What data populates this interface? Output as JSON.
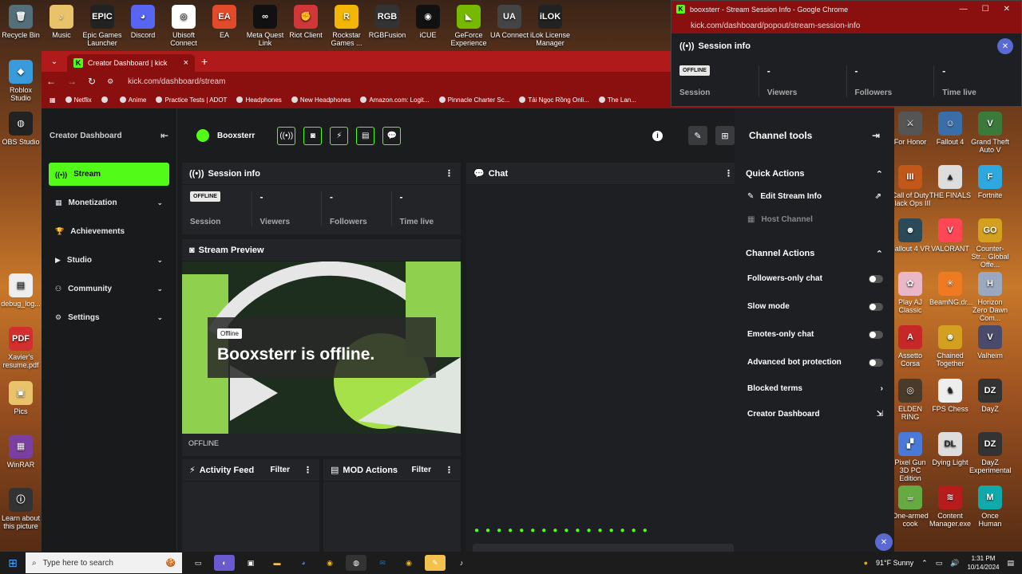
{
  "desktop": {
    "top_icons": [
      {
        "label": "Recycle Bin",
        "glyph": "🗑",
        "bg": "#546e7a"
      },
      {
        "label": "Music",
        "glyph": "♪",
        "bg": "#e8c36a"
      },
      {
        "label": "Epic Games Launcher",
        "glyph": "EPIC",
        "bg": "#222"
      },
      {
        "label": "Discord",
        "glyph": "◕",
        "bg": "#5865f2"
      },
      {
        "label": "Ubisoft Connect",
        "glyph": "◎",
        "bg": "#fff"
      },
      {
        "label": "EA",
        "glyph": "EA",
        "bg": "#e24a2a"
      },
      {
        "label": "Meta Quest Link",
        "glyph": "∞",
        "bg": "#111"
      },
      {
        "label": "Riot Client",
        "glyph": "✊",
        "bg": "#d13639"
      },
      {
        "label": "Rockstar Games ...",
        "glyph": "R",
        "bg": "#f2b705"
      },
      {
        "label": "RGBFusion",
        "glyph": "RGB",
        "bg": "#333"
      },
      {
        "label": "iCUE",
        "glyph": "◉",
        "bg": "#111"
      },
      {
        "label": "GeForce Experience",
        "glyph": "◣",
        "bg": "#76b900"
      },
      {
        "label": "UA Connect",
        "glyph": "UA",
        "bg": "#444"
      },
      {
        "label": "iLok License Manager",
        "glyph": "iLOK",
        "bg": "#222"
      }
    ],
    "left_icons": [
      {
        "label": "Roblox Studio",
        "glyph": "◆",
        "bg": "#3a9bdc"
      },
      {
        "label": "OBS Studio",
        "glyph": "◍",
        "bg": "#222"
      },
      {
        "label": "debug_log...",
        "glyph": "▤",
        "bg": "#eee"
      },
      {
        "label": "Xavier's resume.pdf",
        "glyph": "PDF",
        "bg": "#d32f2f"
      },
      {
        "label": "Pics",
        "glyph": "▣",
        "bg": "#e8c36a"
      },
      {
        "label": "WinRAR",
        "glyph": "▦",
        "bg": "#7a3fa0"
      },
      {
        "label": "Learn about this picture",
        "glyph": "ⓘ",
        "bg": "#333"
      }
    ],
    "right_icons": [
      {
        "label": "For Honor",
        "glyph": "⚔",
        "bg": "#555"
      },
      {
        "label": "Fallout 4",
        "glyph": "☺",
        "bg": "#3a6ea8"
      },
      {
        "label": "Grand Theft Auto V",
        "glyph": "V",
        "bg": "#3c7a3c"
      },
      {
        "label": "Call of Duty Black Ops III",
        "glyph": "III",
        "bg": "#c2571a"
      },
      {
        "label": "THE FINALS",
        "glyph": "▲",
        "bg": "#ddd"
      },
      {
        "label": "Fortnite",
        "glyph": "F",
        "bg": "#2fa8e0"
      },
      {
        "label": "Fallout 4 VR",
        "glyph": "☻",
        "bg": "#2a4a5a"
      },
      {
        "label": "VALORANT",
        "glyph": "V",
        "bg": "#ff4655"
      },
      {
        "label": "Counter-Str... Global Offe...",
        "glyph": "GO",
        "bg": "#d4a020"
      },
      {
        "label": "Play AJ Classic",
        "glyph": "✿",
        "bg": "#e9b7c7"
      },
      {
        "label": "BeamNG.dr...",
        "glyph": "✳",
        "bg": "#ee7b22"
      },
      {
        "label": "Horizon Zero Dawn Com...",
        "glyph": "H",
        "bg": "#9aa8c0"
      },
      {
        "label": "Assetto Corsa",
        "glyph": "A",
        "bg": "#c62828"
      },
      {
        "label": "Chained Together",
        "glyph": "☻",
        "bg": "#d4a020"
      },
      {
        "label": "Valheim",
        "glyph": "V",
        "bg": "#4a4a6a"
      },
      {
        "label": "ELDEN RING",
        "glyph": "◎",
        "bg": "#4a3a2a"
      },
      {
        "label": "FPS Chess",
        "glyph": "♞",
        "bg": "#eee"
      },
      {
        "label": "DayZ",
        "glyph": "DZ",
        "bg": "#333"
      },
      {
        "label": "Pixel Gun 3D PC Edition",
        "glyph": "▞",
        "bg": "#4a7ad8"
      },
      {
        "label": "Dying Light",
        "glyph": "DL",
        "bg": "#ddd"
      },
      {
        "label": "DayZ Experimental",
        "glyph": "DZ",
        "bg": "#333"
      },
      {
        "label": "One-armed cook",
        "glyph": "☕",
        "bg": "#6a4"
      },
      {
        "label": "Content Manager.exe",
        "glyph": "≋",
        "bg": "#b71c1c"
      },
      {
        "label": "Once Human",
        "glyph": "M",
        "bg": "#1aa"
      }
    ]
  },
  "browser": {
    "tab_title": "Creator Dashboard | kick",
    "url": "kick.com/dashboard/stream",
    "bookmarks": [
      "Netflix",
      "",
      "Anime",
      "Practice Tests | ADOT",
      "Headphones",
      "New Headphones",
      "Amazon.com: Logit...",
      "Pinnacle Charter Sc...",
      "Tải Ngọc Rồng Onli...",
      "The Lan..."
    ]
  },
  "sidebar": {
    "title": "Creator Dashboard",
    "items": [
      {
        "label": "Stream",
        "icon": "((•))",
        "active": true,
        "expandable": false
      },
      {
        "label": "Monetization",
        "icon": "▦",
        "active": false,
        "expandable": true
      },
      {
        "label": "Achievements",
        "icon": "🏆",
        "active": false,
        "expandable": false
      },
      {
        "label": "Studio",
        "icon": "▶",
        "active": false,
        "expandable": true
      },
      {
        "label": "Community",
        "icon": "⚇",
        "active": false,
        "expandable": true
      },
      {
        "label": "Settings",
        "icon": "⚙",
        "active": false,
        "expandable": true
      }
    ]
  },
  "topbar": {
    "username": "Booxsterr"
  },
  "session": {
    "title": "Session info",
    "status_badge": "OFFLINE",
    "stats": [
      {
        "value": "",
        "label": "Session"
      },
      {
        "value": "-",
        "label": "Viewers"
      },
      {
        "value": "-",
        "label": "Followers"
      },
      {
        "value": "-",
        "label": "Time live"
      }
    ]
  },
  "preview": {
    "title": "Stream Preview",
    "badge": "Offline",
    "message": "Booxsterr is offline.",
    "footer": "OFFLINE"
  },
  "chat": {
    "title": "Chat"
  },
  "activity": {
    "title": "Activity Feed",
    "filter": "Filter"
  },
  "mod": {
    "title": "MOD Actions",
    "filter": "Filter"
  },
  "tools": {
    "title": "Channel tools",
    "quick_title": "Quick Actions",
    "quick": [
      {
        "label": "Edit Stream Info",
        "dim": false
      },
      {
        "label": "Host Channel",
        "dim": true
      }
    ],
    "channel_title": "Channel Actions",
    "toggles": [
      "Followers-only chat",
      "Slow mode",
      "Emotes-only chat",
      "Advanced bot protection"
    ],
    "blocked_terms": "Blocked terms",
    "creator_dashboard": "Creator Dashboard"
  },
  "popout": {
    "window_title": "booxsterr - Stream Session Info - Google Chrome",
    "url": "kick.com/dashboard/popout/stream-session-info",
    "heading": "Session info",
    "status_badge": "OFFLINE",
    "stats": [
      {
        "value": "",
        "label": "Session"
      },
      {
        "value": "-",
        "label": "Viewers"
      },
      {
        "value": "-",
        "label": "Followers"
      },
      {
        "value": "-",
        "label": "Time live"
      }
    ]
  },
  "taskbar": {
    "search_placeholder": "Type here to search",
    "weather": "91°F  Sunny",
    "time": "1:31 PM",
    "date": "10/14/2024"
  }
}
